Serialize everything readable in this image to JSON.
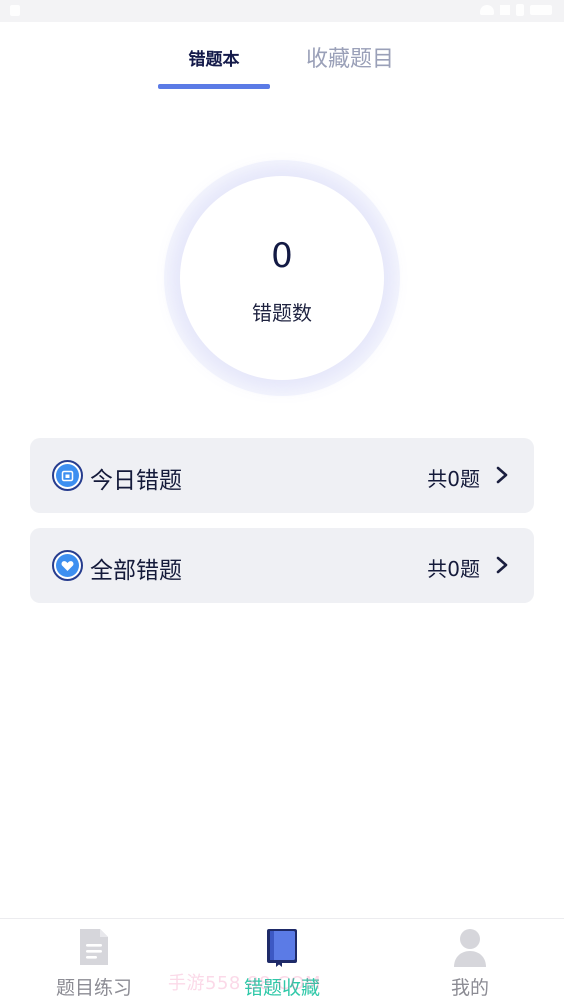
{
  "tabs": [
    {
      "label": "错题本",
      "active": true
    },
    {
      "label": "收藏题目",
      "active": false
    }
  ],
  "summary": {
    "count": "0",
    "label": "错题数"
  },
  "cards": [
    {
      "title": "今日错题",
      "count_text": "共0题",
      "icon": "calendar-icon"
    },
    {
      "title": "全部错题",
      "count_text": "共0题",
      "icon": "heart-icon"
    }
  ],
  "bottom_nav": [
    {
      "label": "题目练习",
      "icon": "document-icon",
      "active": false
    },
    {
      "label": "错题收藏",
      "icon": "book-icon",
      "active": true
    },
    {
      "label": "我的",
      "icon": "user-icon",
      "active": false
    }
  ],
  "watermark": "手游558 88.COM",
  "colors": {
    "accent": "#5b7be6",
    "nav_active": "#2fc8a8",
    "card_bg": "#eff0f4",
    "icon_blue": "#3d8ff0"
  }
}
